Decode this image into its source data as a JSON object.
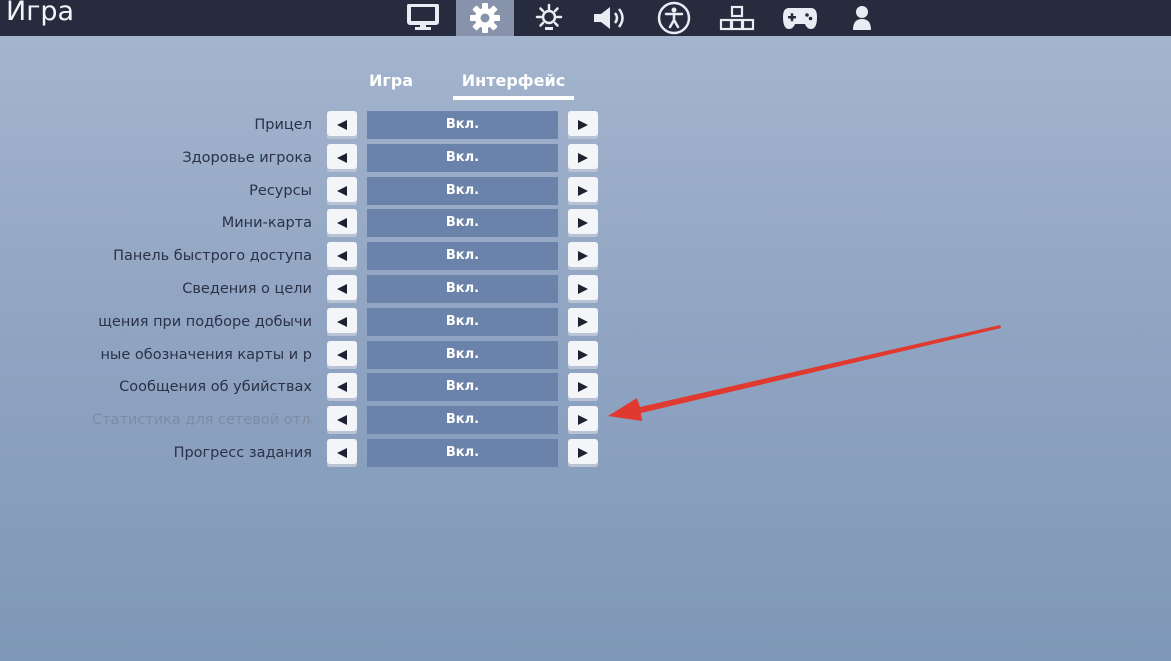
{
  "header": {
    "title": "Игра",
    "nav_icons": [
      {
        "name": "display-icon",
        "active": false
      },
      {
        "name": "gear-icon",
        "active": true
      },
      {
        "name": "brightness-icon",
        "active": false
      },
      {
        "name": "speaker-icon",
        "active": false
      },
      {
        "name": "accessibility-icon",
        "active": false
      },
      {
        "name": "input-keys-icon",
        "active": false
      },
      {
        "name": "gamepad-icon",
        "active": false
      },
      {
        "name": "account-icon",
        "active": false
      }
    ]
  },
  "subtabs": [
    {
      "label": "Игра",
      "active": false
    },
    {
      "label": "Интерфейс",
      "active": true
    }
  ],
  "settings": [
    {
      "label": "Прицел",
      "value": "Вкл.",
      "dim": false
    },
    {
      "label": "Здоровье игрока",
      "value": "Вкл.",
      "dim": false
    },
    {
      "label": "Ресурсы",
      "value": "Вкл.",
      "dim": false
    },
    {
      "label": "Мини-карта",
      "value": "Вкл.",
      "dim": false
    },
    {
      "label": "Панель быстрого доступа",
      "value": "Вкл.",
      "dim": false
    },
    {
      "label": "Сведения о цели",
      "value": "Вкл.",
      "dim": false
    },
    {
      "label": "щения при подборе добычи",
      "value": "Вкл.",
      "dim": false
    },
    {
      "label": "ные обозначения карты и р",
      "value": "Вкл.",
      "dim": false
    },
    {
      "label": "Сообщения об убийствах",
      "value": "Вкл.",
      "dim": false
    },
    {
      "label": "Статистика для сетевой отла",
      "value": "Вкл.",
      "dim": true
    },
    {
      "label": "Прогресс задания",
      "value": "Вкл.",
      "dim": false
    }
  ],
  "colors": {
    "topbar": "#262b3d",
    "value_box": "#6b83aa",
    "annotation_arrow": "#e0392f"
  }
}
